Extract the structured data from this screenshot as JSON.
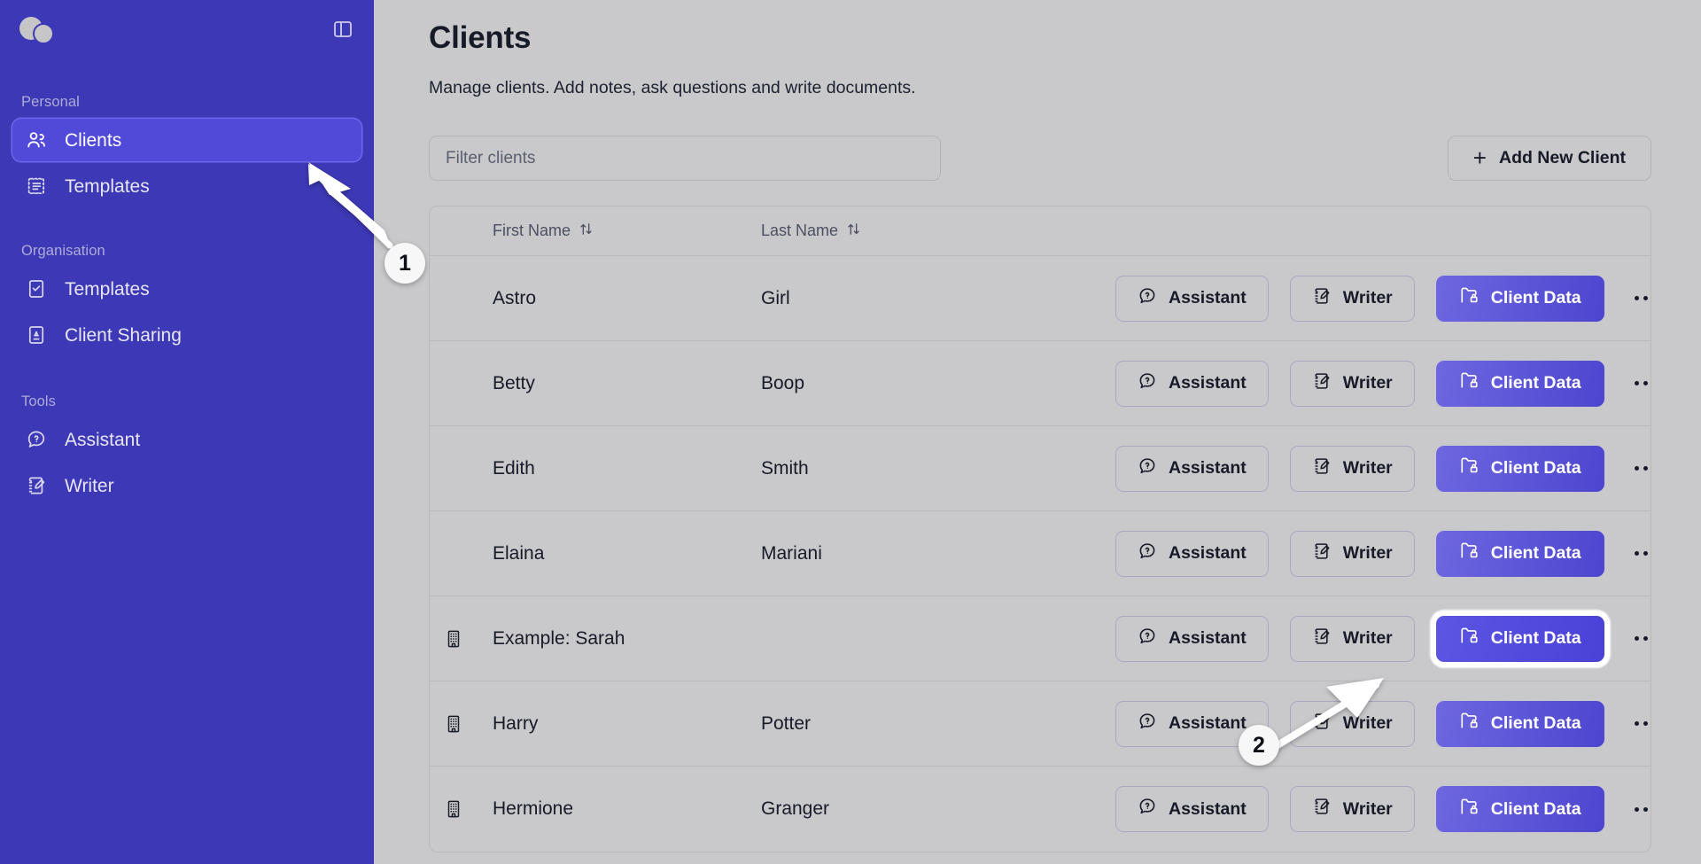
{
  "app": {
    "logo_name": "app-logo",
    "sidebar_toggle_label": "Toggle sidebar"
  },
  "sidebar": {
    "groups": [
      {
        "label": "Personal",
        "items": [
          {
            "label": "Clients",
            "icon": "users-icon",
            "active": true
          },
          {
            "label": "Templates",
            "icon": "template-list-icon",
            "active": false
          }
        ]
      },
      {
        "label": "Organisation",
        "items": [
          {
            "label": "Templates",
            "icon": "checked-document-icon",
            "active": false
          },
          {
            "label": "Client Sharing",
            "icon": "id-card-icon",
            "active": false
          }
        ]
      },
      {
        "label": "Tools",
        "items": [
          {
            "label": "Assistant",
            "icon": "chat-question-icon",
            "active": false
          },
          {
            "label": "Writer",
            "icon": "notebook-pencil-icon",
            "active": false
          }
        ]
      }
    ]
  },
  "page": {
    "title": "Clients",
    "subtitle": "Manage clients. Add notes, ask questions and write documents."
  },
  "toolbar": {
    "filter_placeholder": "Filter clients",
    "filter_value": "",
    "add_button_label": "Add New Client",
    "add_button_icon": "plus-icon"
  },
  "table": {
    "columns": [
      {
        "label": "First Name",
        "sortable": true,
        "sort_icon": "sort-arrows-icon"
      },
      {
        "label": "Last Name",
        "sortable": true,
        "sort_icon": "sort-arrows-icon"
      }
    ],
    "action_labels": {
      "assistant": "Assistant",
      "writer": "Writer",
      "client_data": "Client Data",
      "more": "More options"
    },
    "action_icons": {
      "assistant": "chat-question-icon",
      "writer": "notebook-pencil-icon",
      "client_data": "locked-folder-icon",
      "more": "ellipsis-icon"
    },
    "rows": [
      {
        "first_name": "Astro",
        "last_name": "Girl",
        "org_icon": false,
        "focused": false
      },
      {
        "first_name": "Betty",
        "last_name": "Boop",
        "org_icon": false,
        "focused": false
      },
      {
        "first_name": "Edith",
        "last_name": "Smith",
        "org_icon": false,
        "focused": false
      },
      {
        "first_name": "Elaina",
        "last_name": "Mariani",
        "org_icon": false,
        "focused": false
      },
      {
        "first_name": "Example: Sarah",
        "last_name": "",
        "org_icon": true,
        "focused": true
      },
      {
        "first_name": "Harry",
        "last_name": "Potter",
        "org_icon": true,
        "focused": false
      },
      {
        "first_name": "Hermione",
        "last_name": "Granger",
        "org_icon": true,
        "focused": false
      }
    ]
  },
  "annotations": [
    {
      "number": "1",
      "target": "sidebar-item-clients"
    },
    {
      "number": "2",
      "target": "client-data-button-row-5"
    }
  ],
  "colors": {
    "sidebar_bg": "#3d38b5",
    "sidebar_active": "#5149d8",
    "page_bg": "#c9c9cb",
    "primary_button": "#4d45cf",
    "text": "#171a27"
  }
}
